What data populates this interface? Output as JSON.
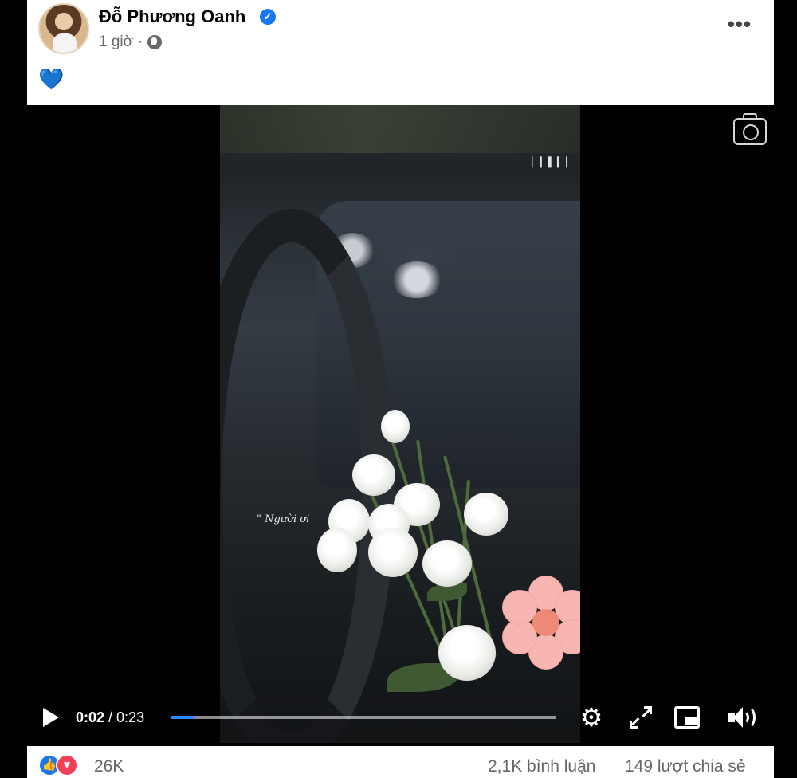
{
  "post": {
    "author_name": "Đỗ Phương Oanh",
    "timestamp": "1 giờ",
    "separator": "·",
    "privacy_icon": "globe-icon",
    "verified_icon": "verified-badge-icon",
    "more_icon": "more-options-icon",
    "text": "💙"
  },
  "video": {
    "lyric_overlay": "\" Người ơi",
    "sound_indicator": "❘❙❚❙❘",
    "current_time": "0:02",
    "time_separator": " / ",
    "duration": "0:23",
    "progress_fraction": 0.065,
    "accent_color": "#2d88ff",
    "icons": {
      "camera": "camera-icon",
      "play": "play-icon",
      "settings": "gear-icon",
      "fullscreen": "fullscreen-icon",
      "pip": "picture-in-picture-icon",
      "volume": "volume-icon"
    }
  },
  "reactions": {
    "like_icon": "like-icon",
    "love_icon": "love-icon",
    "count": "26K",
    "comments": "2,1K bình luận",
    "shares": "149 lượt chia sẻ",
    "like_color": "#1877f2",
    "love_color": "#f33e58"
  }
}
